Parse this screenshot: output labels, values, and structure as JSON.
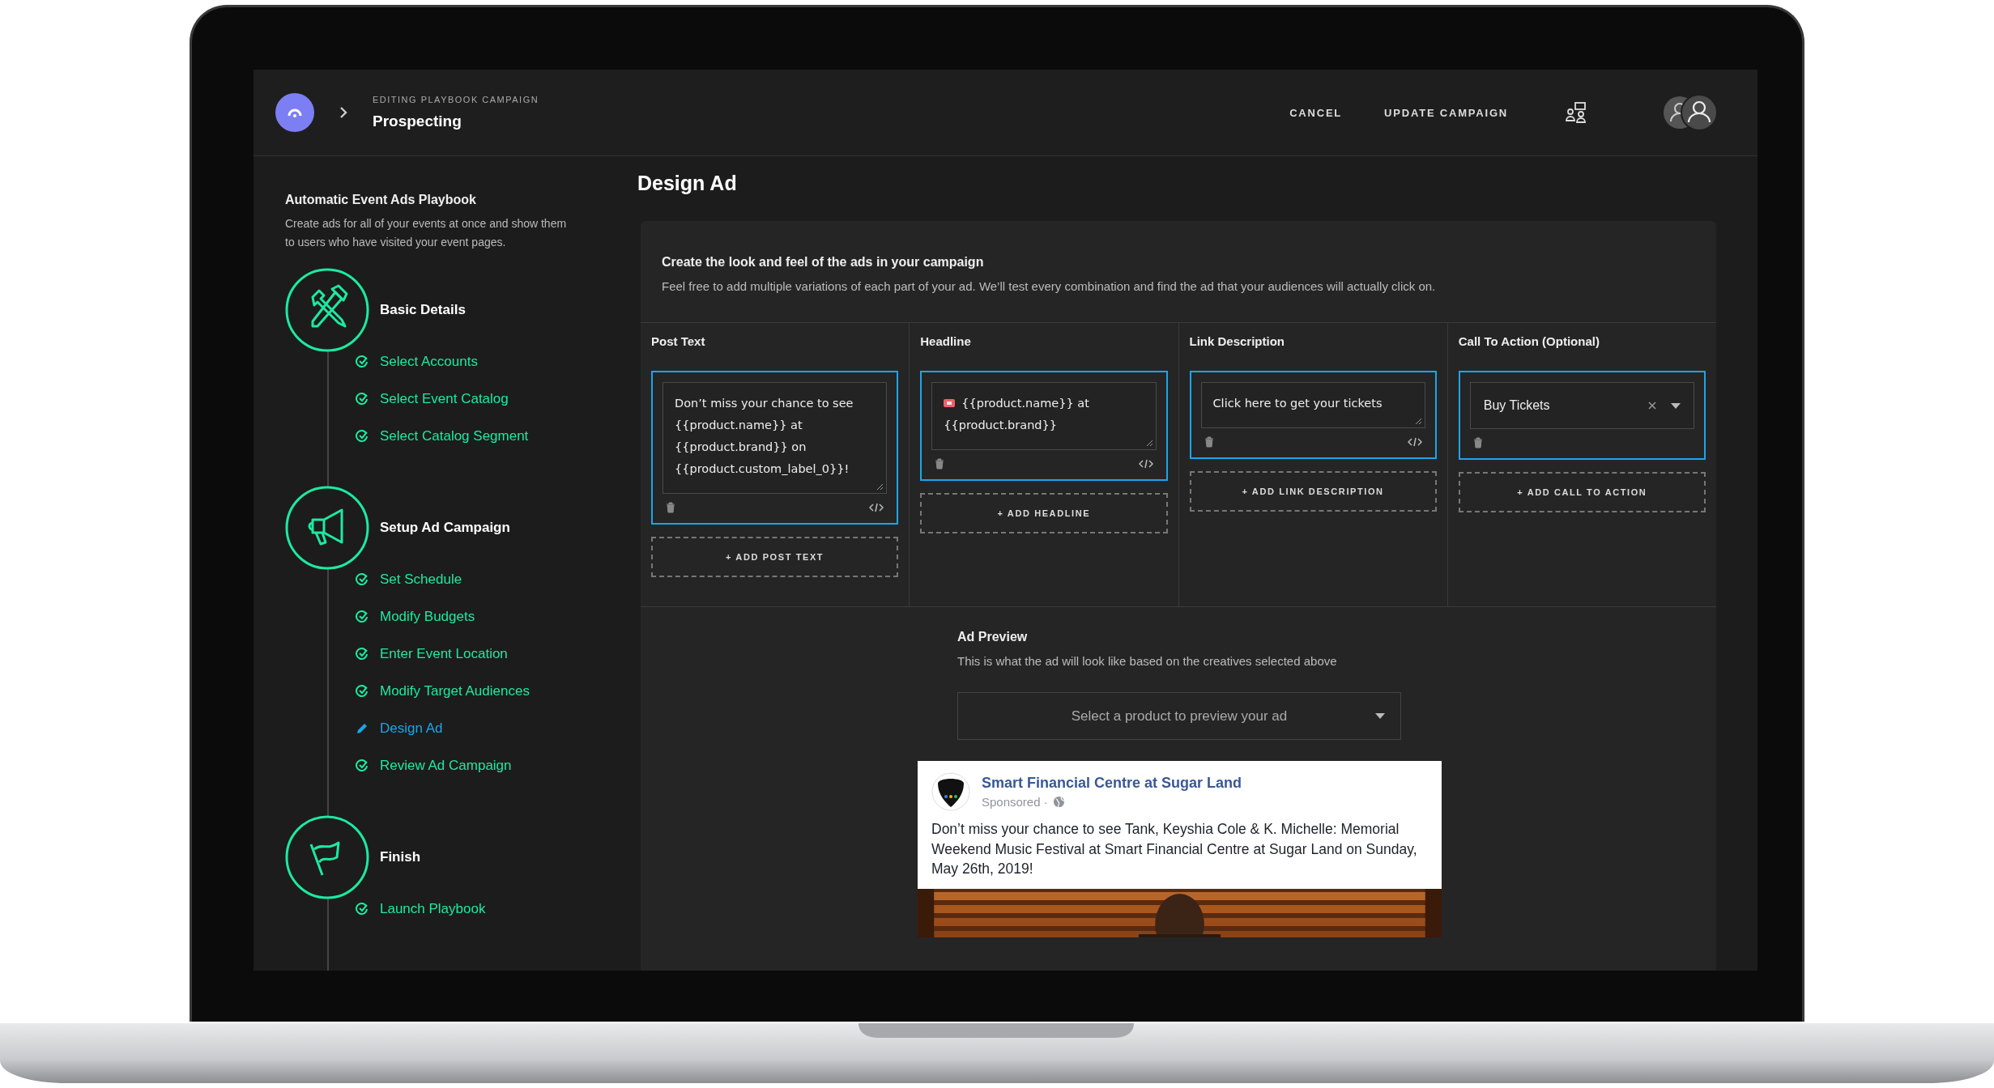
{
  "header": {
    "breadcrumb_label": "EDITING PLAYBOOK CAMPAIGN",
    "title": "Prospecting",
    "actions": [
      "CANCEL",
      "UPDATE CAMPAIGN"
    ]
  },
  "sidebar": {
    "title": "Automatic Event Ads Playbook",
    "description": "Create ads for all of your events at once and show them to users who have visited your event pages.",
    "sections": [
      {
        "title": "Basic Details",
        "items": [
          {
            "label": "Select Accounts",
            "selected": false
          },
          {
            "label": "Select Event Catalog",
            "selected": false
          },
          {
            "label": "Select Catalog Segment",
            "selected": false
          }
        ]
      },
      {
        "title": "Setup Ad Campaign",
        "items": [
          {
            "label": "Set Schedule",
            "selected": false
          },
          {
            "label": "Modify Budgets",
            "selected": false
          },
          {
            "label": "Enter Event Location",
            "selected": false
          },
          {
            "label": "Modify Target Audiences",
            "selected": false
          },
          {
            "label": "Design Ad",
            "selected": true
          },
          {
            "label": "Review Ad Campaign",
            "selected": false
          }
        ]
      },
      {
        "title": "Finish",
        "items": [
          {
            "label": "Launch Playbook",
            "selected": false
          }
        ]
      }
    ]
  },
  "page_title": "Design Ad",
  "intro": {
    "title": "Create the look and feel of the ads in your campaign",
    "text": "Feel free to add multiple variations of each part of your ad. We’ll test every combination and find the ad that your audiences will actually click on."
  },
  "columns": [
    {
      "title": "Post Text",
      "kind": "text",
      "entries": [
        {
          "value": "Don’t miss your chance to see {{product.name}} at {{product.brand}} on {{product.custom_label_0}}!",
          "ticket_icon": false
        }
      ],
      "add_label": "+ ADD POST TEXT"
    },
    {
      "title": "Headline",
      "kind": "text",
      "entries": [
        {
          "value": "{{product.name}} at {{product.brand}}",
          "ticket_icon": true
        }
      ],
      "add_label": "+ ADD HEADLINE"
    },
    {
      "title": "Link Description",
      "kind": "text",
      "entries": [
        {
          "value": "Click here to get your tickets",
          "ticket_icon": false
        }
      ],
      "add_label": "+ ADD LINK DESCRIPTION"
    },
    {
      "title": "Call To Action (Optional)",
      "kind": "select",
      "entries": [
        {
          "value": "Buy Tickets"
        }
      ],
      "add_label": "+ ADD CALL TO ACTION"
    }
  ],
  "preview": {
    "title": "Ad Preview",
    "text": "This is what the ad will look like based on the creatives selected above",
    "select": {
      "placeholder": "Select a product to preview your ad"
    },
    "ad": {
      "page_name": "Smart Financial Centre at Sugar Land",
      "sponsored": "Sponsored ·",
      "body": "Don’t miss your chance to see Tank, Keyshia Cole & K. Michelle: Memorial Weekend Music Festival at Smart Financial Centre at Sugar Land on Sunday, May 26th, 2019!"
    }
  }
}
